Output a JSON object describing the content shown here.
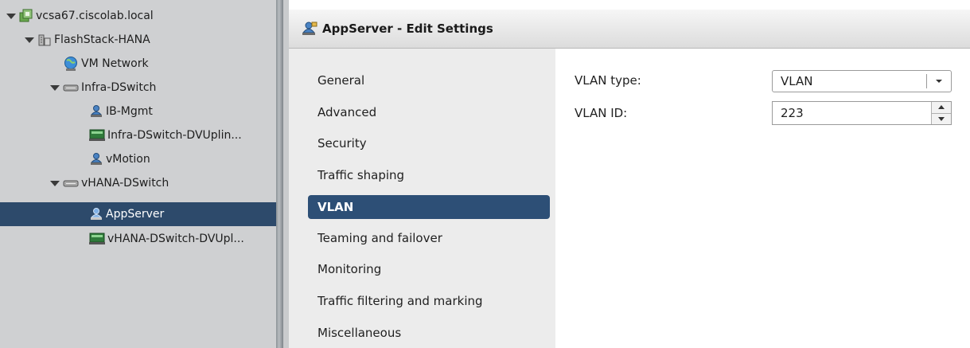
{
  "tree": {
    "items": [
      {
        "label": "vcsa67.ciscolab.local",
        "icon": "vcenter-icon"
      },
      {
        "label": "FlashStack-HANA",
        "icon": "datacenter-icon"
      },
      {
        "label": "VM Network",
        "icon": "network-globe-icon"
      },
      {
        "label": "Infra-DSwitch",
        "icon": "distributed-switch-icon"
      },
      {
        "label": "IB-Mgmt",
        "icon": "port-group-icon"
      },
      {
        "label": "Infra-DSwitch-DVUplin...",
        "icon": "uplink-icon"
      },
      {
        "label": "vMotion",
        "icon": "port-group-icon"
      },
      {
        "label": "vHANA-DSwitch",
        "icon": "distributed-switch-icon"
      },
      {
        "label": "AppServer",
        "icon": "port-group-icon"
      },
      {
        "label": "vHANA-DSwitch-DVUpl...",
        "icon": "uplink-icon"
      }
    ]
  },
  "dialog": {
    "title": "AppServer - Edit Settings",
    "nav": [
      {
        "label": "General"
      },
      {
        "label": "Advanced"
      },
      {
        "label": "Security"
      },
      {
        "label": "Traffic shaping"
      },
      {
        "label": "VLAN"
      },
      {
        "label": "Teaming and failover"
      },
      {
        "label": "Monitoring"
      },
      {
        "label": "Traffic filtering and marking"
      },
      {
        "label": "Miscellaneous"
      }
    ],
    "active_nav": "VLAN",
    "vlan_type": {
      "label": "VLAN type:",
      "value": "VLAN"
    },
    "vlan_id": {
      "label": "VLAN ID:",
      "value": "223"
    }
  },
  "colors": {
    "tree_background": "#cfd0d2",
    "selected": "#2d4a6b",
    "nav_active": "#2d4f76",
    "nav_background": "#ececec"
  }
}
